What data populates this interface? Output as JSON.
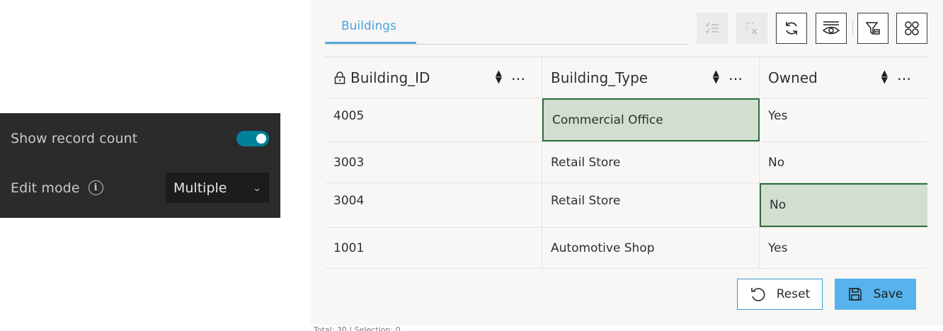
{
  "settings": {
    "show_record_count_label": "Show record count",
    "show_record_count_on": true,
    "edit_mode_label": "Edit mode",
    "edit_mode_value": "Multiple",
    "toggle_color": "#00819a"
  },
  "table": {
    "tab_label": "Buildings",
    "toolbar": [
      {
        "icon": "select-all-icon",
        "enabled": false
      },
      {
        "icon": "clear-selection-icon",
        "enabled": false
      },
      {
        "icon": "refresh-icon",
        "enabled": true
      },
      {
        "icon": "show-hide-eye-icon",
        "enabled": true
      },
      {
        "icon": "filter-icon",
        "enabled": true
      },
      {
        "icon": "more-options-grid-icon",
        "enabled": true
      }
    ],
    "columns": [
      "Building_ID",
      "Building_Type",
      "Owned"
    ],
    "rows": [
      [
        "4005",
        "Commercial Office",
        "Yes"
      ],
      [
        "3003",
        "Retail Store",
        "No"
      ],
      [
        "3004",
        "Retail Store",
        "No"
      ],
      [
        "1001",
        "Automotive Shop",
        "Yes"
      ]
    ],
    "selected_cells": [
      "row0-col1",
      "row2-col2"
    ],
    "reset_label": "Reset",
    "save_label": "Save",
    "footer_text": "Total: 30 | Selection: 0",
    "accent_color": "#56b3ec",
    "selected_cell_color": "#d1dfd1"
  }
}
